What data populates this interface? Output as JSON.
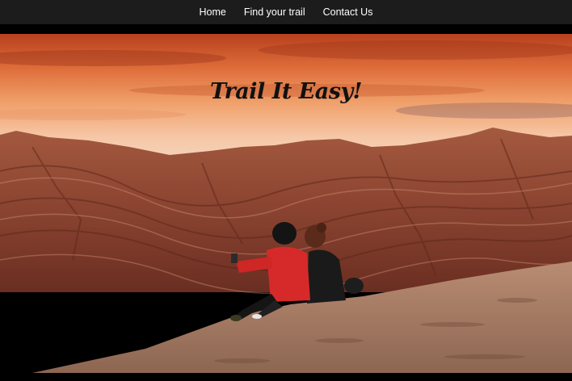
{
  "nav": {
    "items": [
      {
        "label": "Home"
      },
      {
        "label": "Find your trail"
      },
      {
        "label": "Contact Us"
      }
    ]
  },
  "hero": {
    "title": "Trail It Easy!",
    "image_description_icon": "desert-mountain-photo"
  },
  "colors": {
    "nav_bg": "#1c1c1c",
    "nav_text": "#ffffff",
    "sky_top": "#c24a22",
    "sky_mid": "#e98a55",
    "mountain": "#9b5238",
    "title": "#111111"
  }
}
